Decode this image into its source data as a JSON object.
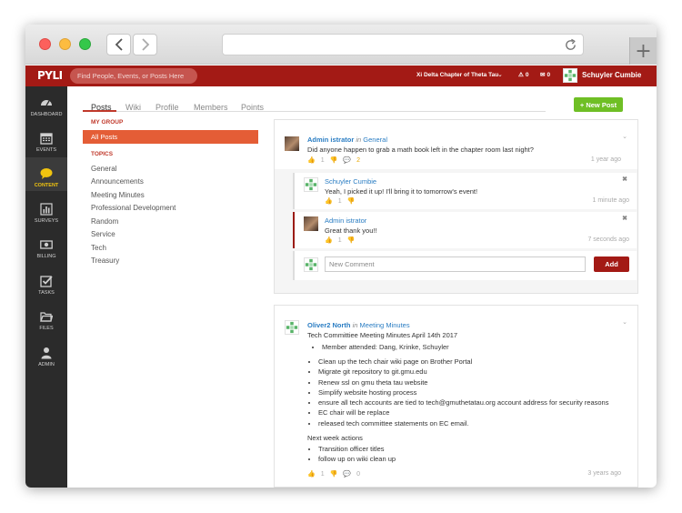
{
  "browser": {
    "back_icon": "chevron-left-icon",
    "forward_icon": "chevron-right-icon",
    "reload_icon": "reload-icon",
    "new_tab_label": "+"
  },
  "appbar": {
    "logo": "PYLI",
    "search_placeholder": "Find People, Events, or Posts Here",
    "chapter": "Xi Delta Chapter of Theta Tau",
    "alerts_count": "0",
    "messages_count": "0",
    "username": "Schuyler Cumbie"
  },
  "sidebar": [
    {
      "label": "DASHBOARD",
      "icon": "dashboard-icon",
      "active": false
    },
    {
      "label": "EVENTS",
      "icon": "calendar-icon",
      "active": false
    },
    {
      "label": "CONTENT",
      "icon": "chat-bubble-icon",
      "active": true
    },
    {
      "label": "SURVEYS",
      "icon": "bar-chart-icon",
      "active": false
    },
    {
      "label": "BILLING",
      "icon": "money-icon",
      "active": false
    },
    {
      "label": "TASKS",
      "icon": "checkbox-icon",
      "active": false
    },
    {
      "label": "FILES",
      "icon": "folder-icon",
      "active": false
    },
    {
      "label": "ADMIN",
      "icon": "user-icon",
      "active": false
    }
  ],
  "subnav": [
    "Posts",
    "Wiki",
    "Profile",
    "Members",
    "Points"
  ],
  "new_post_label": "+ New Post",
  "leftnav": {
    "group_heading": "MY GROUP",
    "all_posts": "All Posts",
    "topics_heading": "TOPICS",
    "topics": [
      "General",
      "Announcements",
      "Meeting Minutes",
      "Professional Development",
      "Random",
      "Service",
      "Tech",
      "Treasury"
    ]
  },
  "post1": {
    "author": "Admin istrator",
    "in": "in",
    "group": "General",
    "text": "Did anyone happen to grab a math book left in the chapter room last night?",
    "likes": "1",
    "comments": "2",
    "time": "1 year ago",
    "replies": [
      {
        "author": "Schuyler Cumbie",
        "text": "Yeah, I picked it up! I'll bring it to tomorrow's event!",
        "likes": "1",
        "time": "1 minute ago"
      },
      {
        "author": "Admin istrator",
        "text": "Great thank you!!",
        "likes": "1",
        "time": "7 seconds ago"
      }
    ],
    "comment_placeholder": "New Comment",
    "add_label": "Add"
  },
  "post2": {
    "author": "Oliver2 North",
    "in": "in",
    "group": "Meeting Minutes",
    "title": "Tech Committiee Meeting Minutes April 14th 2017",
    "attended": "Member attended: Dang, Krinke, Schuyler",
    "items": [
      "Clean up the tech chair wiki page on Brother Portal",
      "Migrate git repository to git.gmu.edu",
      "Renew ssl on gmu theta tau website",
      "Simplify website hosting process",
      "ensure all tech accounts are tied to tech@gmuthetatau.org account address for security reasons",
      "EC chair will be replace",
      "released tech committee statements on EC email."
    ],
    "next_heading": "Next week actions",
    "next_items": [
      "Transition officer titles",
      "follow up on wiki clean up"
    ],
    "likes": "1",
    "comments": "0",
    "time": "3 years ago"
  },
  "colors": {
    "brand": "#a31a15",
    "accent": "#e45d36",
    "green": "#6fbf25",
    "link": "#2a7dc3"
  }
}
